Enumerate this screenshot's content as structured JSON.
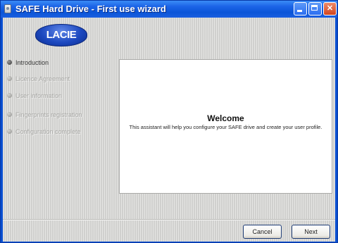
{
  "window": {
    "title": "SAFE Hard Drive - First use wizard"
  },
  "logo": {
    "text": "LACIE"
  },
  "steps": [
    {
      "label": "Introduction",
      "state": "active"
    },
    {
      "label": "Licence Agreement",
      "state": "inactive"
    },
    {
      "label": "User information",
      "state": "inactive"
    },
    {
      "label": "Fingerprints registration",
      "state": "inactive"
    },
    {
      "label": "Configuration complete",
      "state": "inactive"
    }
  ],
  "panel": {
    "heading": "Welcome",
    "body": "This assistant will help you configure your SAFE drive and create your user profile."
  },
  "buttons": {
    "cancel_label": "Cancel",
    "next_label": "Next"
  },
  "colors": {
    "titlebar": "#0b55d8",
    "close_button": "#d2451e",
    "client_bg": "#d8d8d6"
  }
}
